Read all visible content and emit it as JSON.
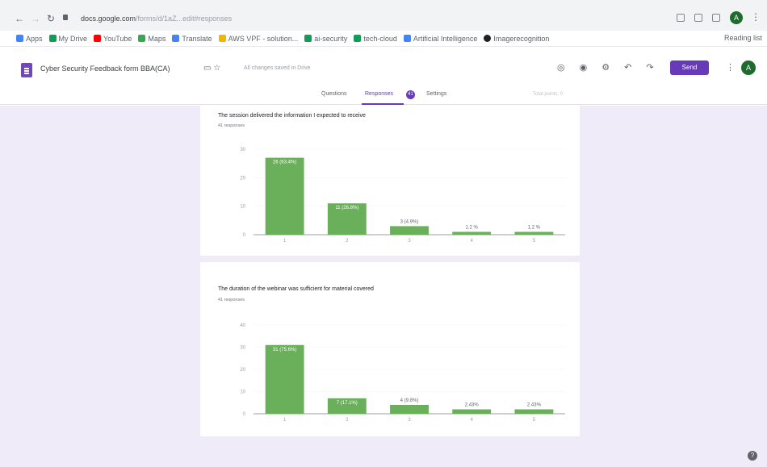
{
  "browser": {
    "url_host": "docs.google.com",
    "url_path": "/forms/d/1aZ...edit#responses",
    "profile_initial": "A"
  },
  "bookmarks": {
    "items": [
      {
        "label": "Apps",
        "color": "#4285f4"
      },
      {
        "label": "My Drive",
        "color": "#0f9d58"
      },
      {
        "label": "YouTube",
        "color": "#ff0000"
      },
      {
        "label": "Maps",
        "color": "#34a853"
      },
      {
        "label": "Translate",
        "color": "#4285f4"
      },
      {
        "label": "AWS VPF - solution...",
        "color": "#f4b400"
      },
      {
        "label": "ai-security",
        "color": "#0f9d58"
      },
      {
        "label": "tech-cloud",
        "color": "#0f9d58"
      },
      {
        "label": "Artificial Intelligence",
        "color": "#4285f4"
      },
      {
        "label": "Imagerecognition",
        "color": "#202124"
      }
    ],
    "right_label": "Reading list"
  },
  "form": {
    "title": "Cyber Security Feedback form BBA(CA)",
    "saved_status": "All changes saved in Drive",
    "send_label": "Send",
    "user_initial": "A"
  },
  "tabs": {
    "questions": "Questions",
    "responses": "Responses",
    "responses_count": "41",
    "settings": "Settings",
    "total_points": "Total points: 0"
  },
  "chart_data": [
    {
      "type": "bar",
      "title": "The session delivered the information I expected to receive",
      "response_count": "41 responses",
      "categories": [
        "1",
        "2",
        "3",
        "4",
        "5"
      ],
      "values": [
        27,
        11,
        3,
        1,
        1
      ],
      "labels": [
        "26 (63.4%)",
        "11 (26.8%)",
        "3 (4.9%)",
        "1.2 %",
        "1.2 %"
      ],
      "ylim": [
        0,
        30
      ],
      "yticks": [
        0,
        10,
        20,
        30
      ],
      "color": "#6aaf5a"
    },
    {
      "type": "bar",
      "title": "The duration of the webinar was sufficient for material covered",
      "response_count": "41 responses",
      "categories": [
        "1",
        "2",
        "3",
        "4",
        "5"
      ],
      "values": [
        31,
        7,
        4,
        2,
        2
      ],
      "labels": [
        "31 (75.6%)",
        "7 (17.1%)",
        "4 (9.8%)",
        "2.43%",
        "2.43%"
      ],
      "ylim": [
        0,
        40
      ],
      "yticks": [
        0,
        10,
        20,
        30,
        40
      ],
      "color": "#6aaf5a"
    }
  ]
}
